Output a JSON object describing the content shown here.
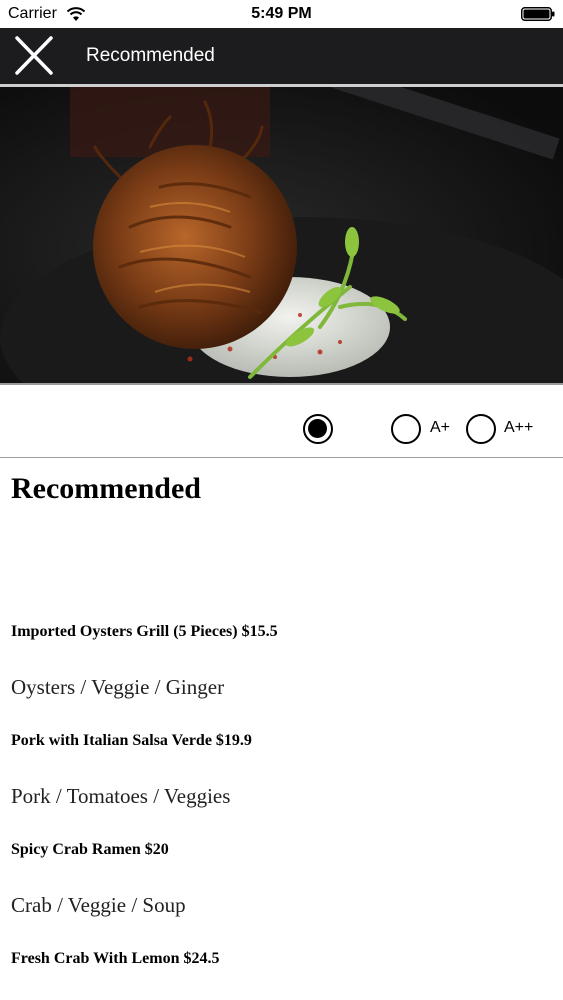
{
  "status_bar": {
    "carrier": "Carrier",
    "time": "5:49 PM"
  },
  "nav": {
    "title": "Recommended",
    "close_icon": "close-x-icon"
  },
  "hero": {
    "image": "fried-dish-with-herb-yogurt-photo"
  },
  "rating_filter": {
    "options": [
      {
        "label": "",
        "selected": true
      },
      {
        "label": "A+",
        "selected": false
      },
      {
        "label": "A++",
        "selected": false
      }
    ]
  },
  "section": {
    "title": "Recommended"
  },
  "menu": {
    "items": [
      {
        "name": "Imported Oysters Grill (5 Pieces) $15.5",
        "desc": "Oysters / Veggie / Ginger"
      },
      {
        "name": "Pork with Italian Salsa Verde $19.9",
        "desc": "Pork / Tomatoes / Veggies"
      },
      {
        "name": "Spicy Crab Ramen $20",
        "desc": "Crab / Veggie / Soup"
      },
      {
        "name": "Fresh Crab With Lemon $24.5",
        "desc": ""
      }
    ]
  },
  "colors": {
    "nav_background": "#1c1c1e",
    "nav_text": "#ffffff",
    "body_background": "#ffffff"
  }
}
